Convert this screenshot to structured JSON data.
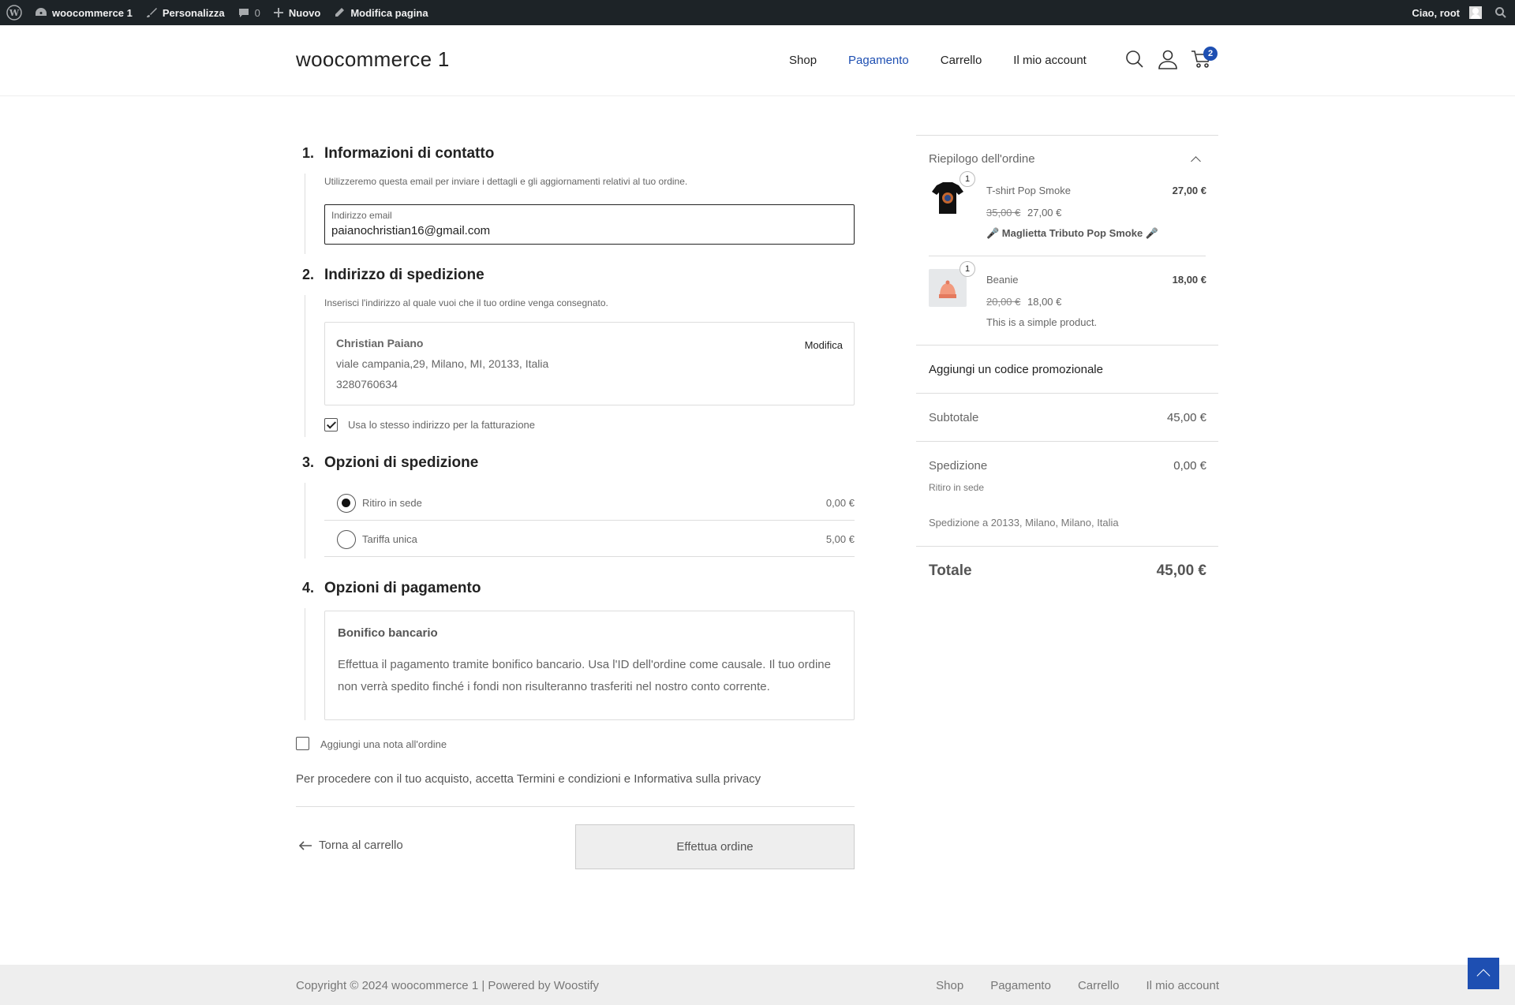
{
  "adminbar": {
    "site": "woocommerce 1",
    "customize": "Personalizza",
    "comments": "0",
    "new": "Nuovo",
    "edit_page": "Modifica pagina",
    "greeting": "Ciao, root"
  },
  "header": {
    "site_title": "woocommerce 1",
    "nav": [
      "Shop",
      "Pagamento",
      "Carrello",
      "Il mio account"
    ],
    "active_nav": "Pagamento",
    "cart_count": "2"
  },
  "checkout": {
    "step1": {
      "num": "1.",
      "title": "Informazioni di contatto",
      "desc": "Utilizzeremo questa email per inviare i dettagli e gli aggiornamenti relativi al tuo ordine.",
      "email_label": "Indirizzo email",
      "email_value": "paianochristian16@gmail.com"
    },
    "step2": {
      "num": "2.",
      "title": "Indirizzo di spedizione",
      "desc": "Inserisci l'indirizzo al quale vuoi che il tuo ordine venga consegnato.",
      "name": "Christian Paiano",
      "address": "viale campania,29, Milano, MI, 20133, Italia",
      "phone": "3280760634",
      "edit": "Modifica",
      "same_billing": "Usa lo stesso indirizzo per la fatturazione",
      "same_billing_checked": true
    },
    "step3": {
      "num": "3.",
      "title": "Opzioni di spedizione",
      "options": [
        {
          "name": "Ritiro in sede",
          "price": "0,00 €",
          "selected": true
        },
        {
          "name": "Tariffa unica",
          "price": "5,00 €",
          "selected": false
        }
      ]
    },
    "step4": {
      "num": "4.",
      "title": "Opzioni di pagamento",
      "method": "Bonifico bancario",
      "method_desc": "Effettua il pagamento tramite bonifico bancario. Usa l'ID dell'ordine come causale. Il tuo ordine non verrà spedito finché i fondi non risulteranno trasferiti nel nostro conto corrente."
    },
    "order_note": "Aggiungi una nota all'ordine",
    "terms": "Per procedere con il tuo acquisto, accetta Termini e condizioni e Informativa sulla privacy",
    "back": "Torna al carrello",
    "place_order": "Effettua ordine"
  },
  "summary": {
    "title": "Riepilogo dell'ordine",
    "items": [
      {
        "name": "T-shirt Pop Smoke",
        "qty": "1",
        "price": "27,00 €",
        "old_price": "35,00 €",
        "new_price": "27,00 €",
        "desc": "🎤 Maglietta Tributo Pop Smoke 🎤"
      },
      {
        "name": "Beanie",
        "qty": "1",
        "price": "18,00 €",
        "old_price": "20,00 €",
        "new_price": "18,00 €",
        "desc": "This is a simple product."
      }
    ],
    "coupon": "Aggiungi un codice promozionale",
    "subtotal_label": "Subtotale",
    "subtotal": "45,00 €",
    "shipping_label": "Spedizione",
    "shipping": "0,00 €",
    "shipping_method": "Ritiro in sede",
    "shipping_to": "Spedizione a 20133, Milano, Milano, Italia",
    "total_label": "Totale",
    "total": "45,00 €"
  },
  "footer": {
    "copyright": "Copyright © 2024 woocommerce 1 | Powered by Woostify",
    "nav": [
      "Shop",
      "Pagamento",
      "Carrello",
      "Il mio account"
    ]
  }
}
